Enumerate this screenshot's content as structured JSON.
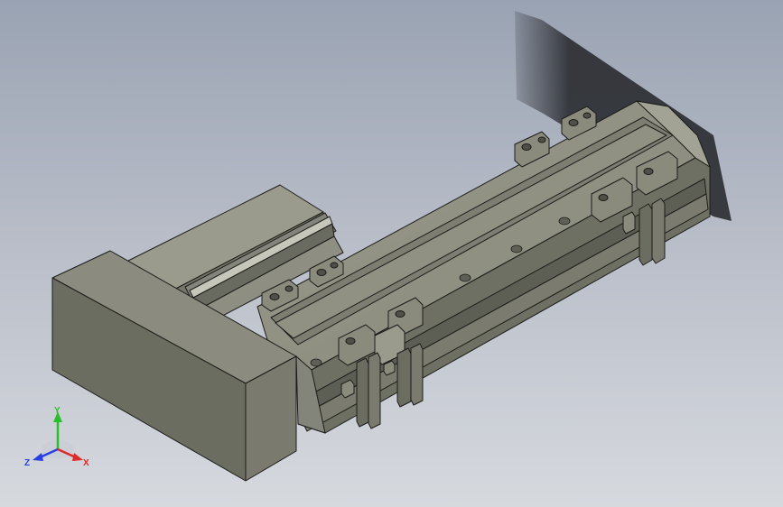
{
  "viewport": {
    "name": "3D model view",
    "colors": {
      "background_top": "#9aa3b3",
      "background_bottom": "#d6d9de",
      "body_light": "#8d8e80",
      "body_mid": "#76776a",
      "body_dark": "#4f5048",
      "edge": "#1c1c1a",
      "shadow": "#2a2c31"
    }
  },
  "triad": {
    "x_label": "X",
    "y_label": "Y",
    "z_label": "Z",
    "x_color": "#e02a2a",
    "y_color": "#2bbf2b",
    "z_color": "#2a3fe0"
  }
}
